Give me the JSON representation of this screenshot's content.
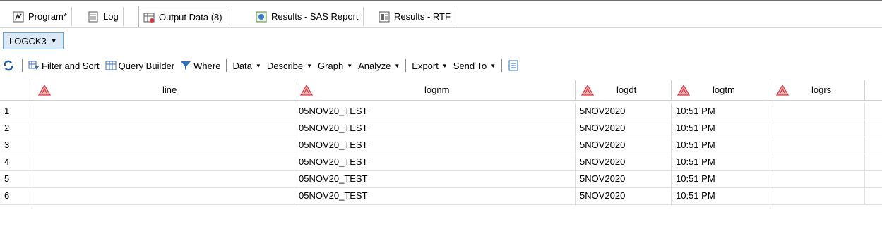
{
  "tabs": [
    {
      "label": "Program*",
      "icon": "program-icon",
      "active": false
    },
    {
      "label": "Log",
      "icon": "log-icon",
      "active": false
    },
    {
      "label": "Output Data (8)",
      "icon": "output-data-icon",
      "active": true
    },
    {
      "label": "Results - SAS Report",
      "icon": "sas-report-icon",
      "active": false
    },
    {
      "label": "Results - RTF",
      "icon": "rtf-icon",
      "active": false
    }
  ],
  "dataset_selector": {
    "label": "LOGCK3"
  },
  "toolbar": {
    "refresh_icon": "refresh-icon",
    "filter_sort": "Filter and Sort",
    "query_builder": "Query Builder",
    "where": "Where",
    "data": "Data",
    "describe": "Describe",
    "graph": "Graph",
    "analyze": "Analyze",
    "export": "Export",
    "send_to": "Send To"
  },
  "grid": {
    "columns": [
      "line",
      "lognm",
      "logdt",
      "logtm",
      "logrs"
    ],
    "rows": [
      {
        "n": "1",
        "line": "",
        "lognm": "05NOV20_TEST",
        "logdt": "5NOV2020",
        "logtm": "10:51 PM",
        "logrs": ""
      },
      {
        "n": "2",
        "line": "",
        "lognm": "05NOV20_TEST",
        "logdt": "5NOV2020",
        "logtm": "10:51 PM",
        "logrs": ""
      },
      {
        "n": "3",
        "line": "",
        "lognm": "05NOV20_TEST",
        "logdt": "5NOV2020",
        "logtm": "10:51 PM",
        "logrs": ""
      },
      {
        "n": "4",
        "line": "",
        "lognm": "05NOV20_TEST",
        "logdt": "5NOV2020",
        "logtm": "10:51 PM",
        "logrs": ""
      },
      {
        "n": "5",
        "line": "",
        "lognm": "05NOV20_TEST",
        "logdt": "5NOV2020",
        "logtm": "10:51 PM",
        "logrs": ""
      },
      {
        "n": "6",
        "line": "",
        "lognm": "05NOV20_TEST",
        "logdt": "5NOV2020",
        "logtm": "10:51 PM",
        "logrs": ""
      }
    ]
  },
  "colors": {
    "selector_bg": "#dbe9f7",
    "selector_border": "#6aa0d4",
    "warn_icon": "#d9363e"
  }
}
